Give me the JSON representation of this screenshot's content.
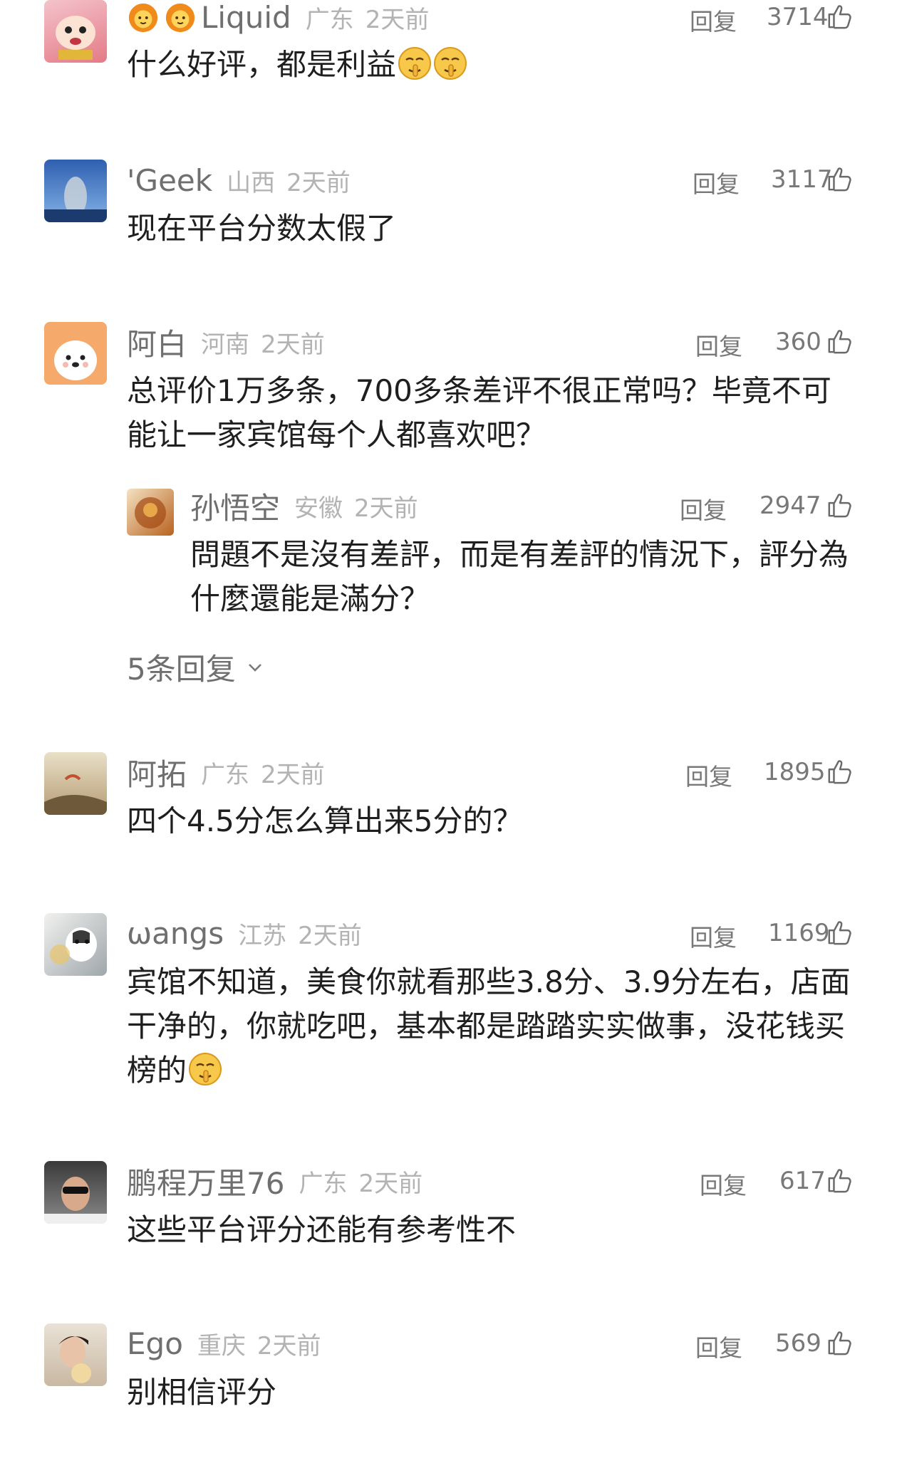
{
  "comments": [
    {
      "name": "Liquid",
      "location": "广东",
      "time": "2天前",
      "reply": "回复",
      "likes": "3714",
      "text": "什么好评，都是利益"
    },
    {
      "name": "'Geek",
      "location": "山西",
      "time": "2天前",
      "reply": "回复",
      "likes": "3117",
      "text": "现在平台分数太假了"
    },
    {
      "name": "阿白",
      "location": "河南",
      "time": "2天前",
      "reply": "回复",
      "likes": "360",
      "text": "总评价1万多条，700多条差评不很正常吗？毕竟不可能让一家宾馆每个人都喜欢吧？",
      "sub_reply": {
        "name": "孙悟空",
        "location": "安徽",
        "time": "2天前",
        "reply": "回复",
        "likes": "2947",
        "text": "問題不是沒有差評，而是有差評的情況下，評分為什麼還能是滿分？"
      },
      "more_replies": "5条回复"
    },
    {
      "name": "阿拓",
      "location": "广东",
      "time": "2天前",
      "reply": "回复",
      "likes": "1895",
      "text": "四个4.5分怎么算出来5分的？"
    },
    {
      "name": "ωangs",
      "location": "江苏",
      "time": "2天前",
      "reply": "回复",
      "likes": "1169",
      "text": "宾馆不知道，美食你就看那些3.8分、3.9分左右，店面干净的，你就吃吧，基本都是踏踏实实做事，没花钱买榜的"
    },
    {
      "name": "鹏程万里76",
      "location": "广东",
      "time": "2天前",
      "reply": "回复",
      "likes": "617",
      "text": "这些平台评分还能有参考性不"
    },
    {
      "name": "Ego",
      "location": "重庆",
      "time": "2天前",
      "reply": "回复",
      "likes": "569",
      "text": "别相信评分"
    }
  ],
  "icons": {
    "like": "thumbs-up-icon",
    "emoji": "shush-face-emoji",
    "badge": "lion-badge-icon",
    "chevron": "chevron-down-icon"
  },
  "colors": {
    "name": "#6f6f6f",
    "meta": "#b3b3b3",
    "text": "#1f1f1f"
  }
}
